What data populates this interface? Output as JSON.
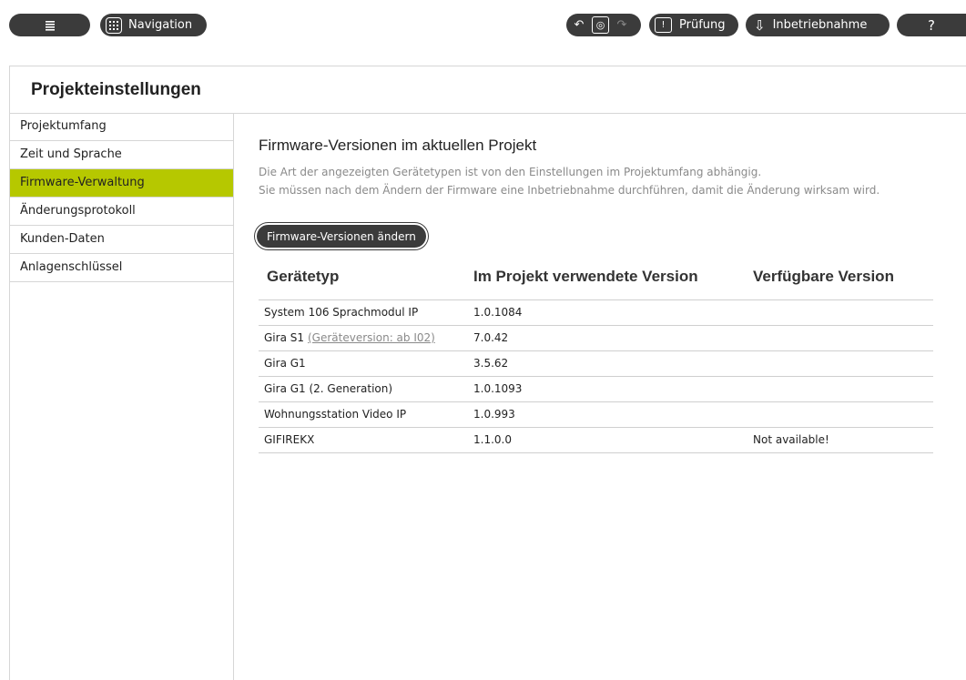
{
  "toolbar": {
    "menu_icon": "list-icon",
    "navigation_label": "Navigation",
    "navigation_icon": "grid-icon",
    "undo_icon": "undo-icon",
    "device_icon": "device-icon",
    "redo_icon": "redo-icon",
    "pruefung_label": "Prüfung",
    "inbetriebnahme_label": "Inbetriebnahme",
    "help_label": "?"
  },
  "header": {
    "title": "Projekteinstellungen"
  },
  "sidebar": {
    "items": [
      {
        "label": "Projektumfang"
      },
      {
        "label": "Zeit und Sprache"
      },
      {
        "label": "Firmware-Verwaltung",
        "active": true
      },
      {
        "label": "Änderungsprotokoll"
      },
      {
        "label": "Kunden-Daten"
      },
      {
        "label": "Anlagenschlüssel"
      }
    ]
  },
  "main": {
    "title": "Firmware-Versionen im aktuellen Projekt",
    "desc_line1": "Die Art der angezeigten Gerätetypen ist von den Einstellungen im Projektumfang abhängig.",
    "desc_line2": "Sie müssen nach dem Ändern der Firmware eine Inbetriebnahme durchführen, damit die Änderung wirksam wird.",
    "change_button": "Firmware-Versionen ändern",
    "table": {
      "headers": [
        "Gerätetyp",
        "Im Projekt verwendete Version",
        "Verfügbare Version"
      ],
      "rows": [
        {
          "device": "System 106 Sprachmodul IP",
          "link": "",
          "version": "1.0.1084",
          "available": ""
        },
        {
          "device": "Gira S1",
          "link": "(Geräteversion: ab I02)",
          "version": "7.0.42",
          "available": ""
        },
        {
          "device": "Gira G1",
          "link": "",
          "version": "3.5.62",
          "available": ""
        },
        {
          "device": "Gira G1 (2. Generation)",
          "link": "",
          "version": "1.0.1093",
          "available": ""
        },
        {
          "device": "Wohnungsstation Video IP",
          "link": "",
          "version": "1.0.993",
          "available": ""
        },
        {
          "device": "GIFIREKX",
          "link": "",
          "version": "1.1.0.0",
          "available": "Not available!"
        }
      ]
    }
  },
  "colors": {
    "accent": "#b6c800",
    "dark": "#3b3b3b",
    "muted": "#8a8a8a"
  }
}
